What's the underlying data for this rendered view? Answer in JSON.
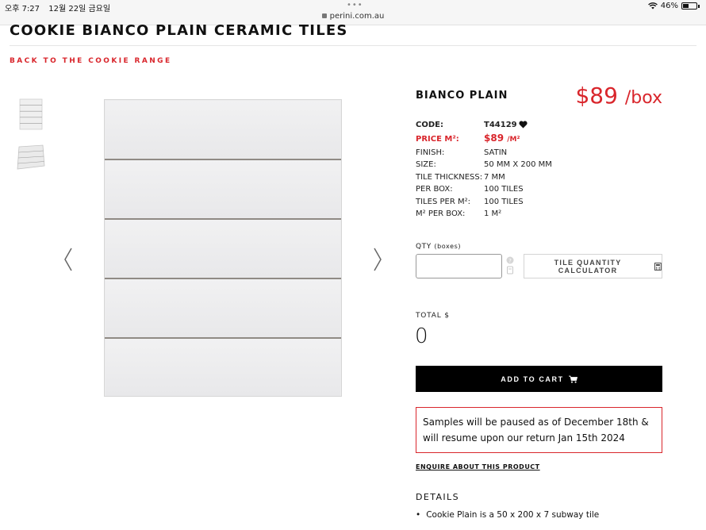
{
  "status_bar": {
    "time": "오후 7:27",
    "date": "12월 22일 금요일",
    "url": "perini.com.au",
    "battery": "46%"
  },
  "page": {
    "title": "COOKIE BIANCO PLAIN CERAMIC TILES",
    "back_link": "BACK TO THE COOKIE RANGE"
  },
  "product": {
    "name": "BIANCO PLAIN",
    "price": "$89",
    "price_unit": "/box",
    "specs": {
      "code_label": "CODE:",
      "code": "T44129",
      "price_m2_label": "PRICE M²:",
      "price_m2": "$89",
      "price_m2_unit": "/M²",
      "finish_label": "FINISH:",
      "finish": "SATIN",
      "size_label": "SIZE:",
      "size": "50 MM X 200 MM",
      "thickness_label": "TILE THICKNESS:",
      "thickness": "7 MM",
      "per_box_label": "PER BOX:",
      "per_box": "100 TILES",
      "tiles_per_m2_label": "TILES PER M²:",
      "tiles_per_m2": "100 TILES",
      "m2_per_box_label": "M² PER BOX:",
      "m2_per_box": "1 M²"
    }
  },
  "order": {
    "qty_label": "QTY",
    "qty_unit": "(boxes)",
    "qty_value": "",
    "calculator_label": "TILE QUANTITY CALCULATOR",
    "total_label": "TOTAL $",
    "total_value": "0",
    "add_to_cart": "ADD TO CART"
  },
  "notice": "Samples will be paused as of December 18th & will resume upon our return Jan 15th 2024",
  "enquire": "ENQUIRE ABOUT THIS PRODUCT",
  "details": {
    "heading": "DETAILS",
    "items": [
      "Cookie Plain is a 50 x 200 x 7 subway tile"
    ]
  },
  "colors": {
    "accent": "#d9262c",
    "cart_button": "#000000"
  },
  "icons": {
    "wishlist": "heart-icon",
    "cart": "cart-icon",
    "calculator": "calculator-icon",
    "prev": "chevron-left-icon",
    "next": "chevron-right-icon"
  }
}
